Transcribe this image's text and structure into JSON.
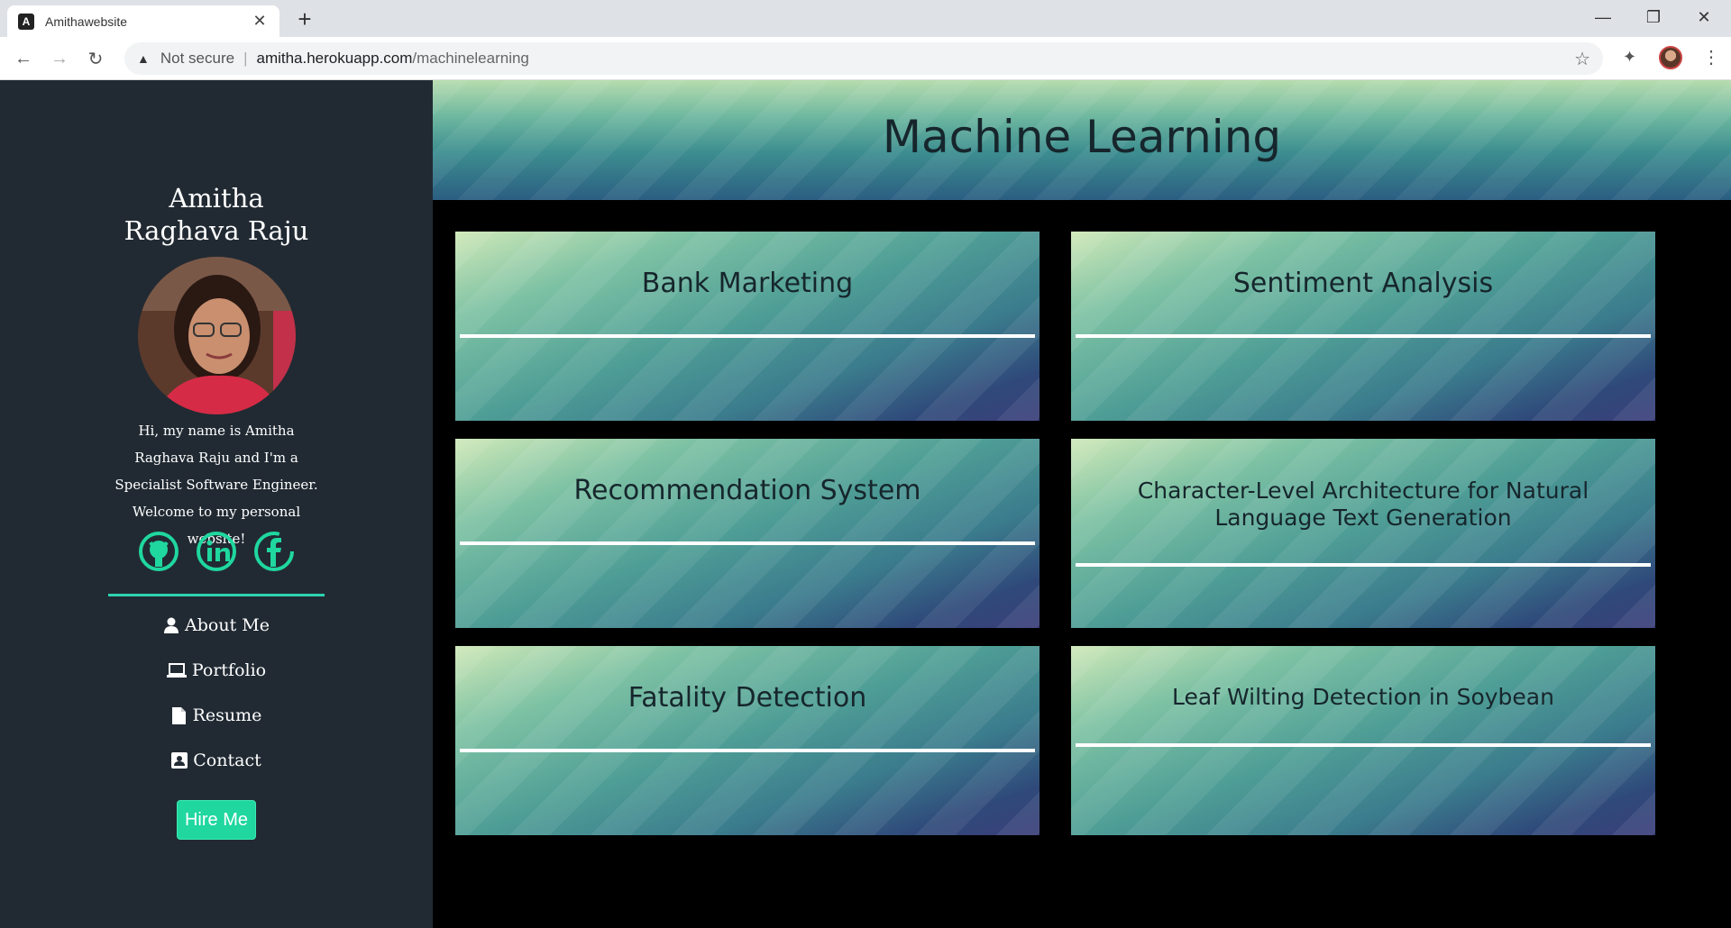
{
  "browser": {
    "tab_title": "Amithawebsite",
    "new_tab": "+",
    "security_label": "Not secure",
    "url_host": "amitha.herokuapp.com",
    "url_path": "/machinelearning"
  },
  "sidebar": {
    "name": "Amitha Raghava Raju",
    "bio": "Hi, my name is Amitha Raghava Raju and I'm a Specialist Software Engineer. Welcome to my personal website!",
    "nav": [
      {
        "label": "About Me",
        "icon": "user-icon"
      },
      {
        "label": "Portfolio",
        "icon": "laptop-icon"
      },
      {
        "label": "Resume",
        "icon": "file-icon"
      },
      {
        "label": "Contact",
        "icon": "contact-card-icon"
      }
    ],
    "hire_button": "Hire Me",
    "accent_color": "#1fd79f"
  },
  "main": {
    "title": "Machine Learning",
    "projects": [
      {
        "title": "Bank Marketing"
      },
      {
        "title": "Sentiment Analysis"
      },
      {
        "title": "Recommendation System"
      },
      {
        "title": "Character-Level Architecture for Natural Language Text Generation"
      },
      {
        "title": "Fatality Detection"
      },
      {
        "title": "Leaf Wilting Detection in Soybean"
      }
    ]
  }
}
